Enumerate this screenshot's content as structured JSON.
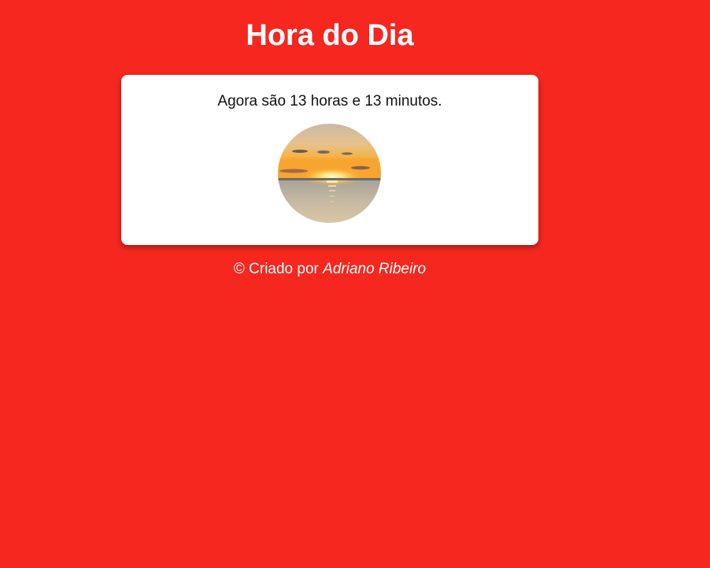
{
  "page": {
    "title": "Hora do Dia",
    "background_color": "#f5271f"
  },
  "card": {
    "message": "Agora são 13 horas e 13 minutos.",
    "image": "sunset-over-sea-photo"
  },
  "footer": {
    "prefix": "© Criado por",
    "author": "Adriano Ribeiro"
  }
}
